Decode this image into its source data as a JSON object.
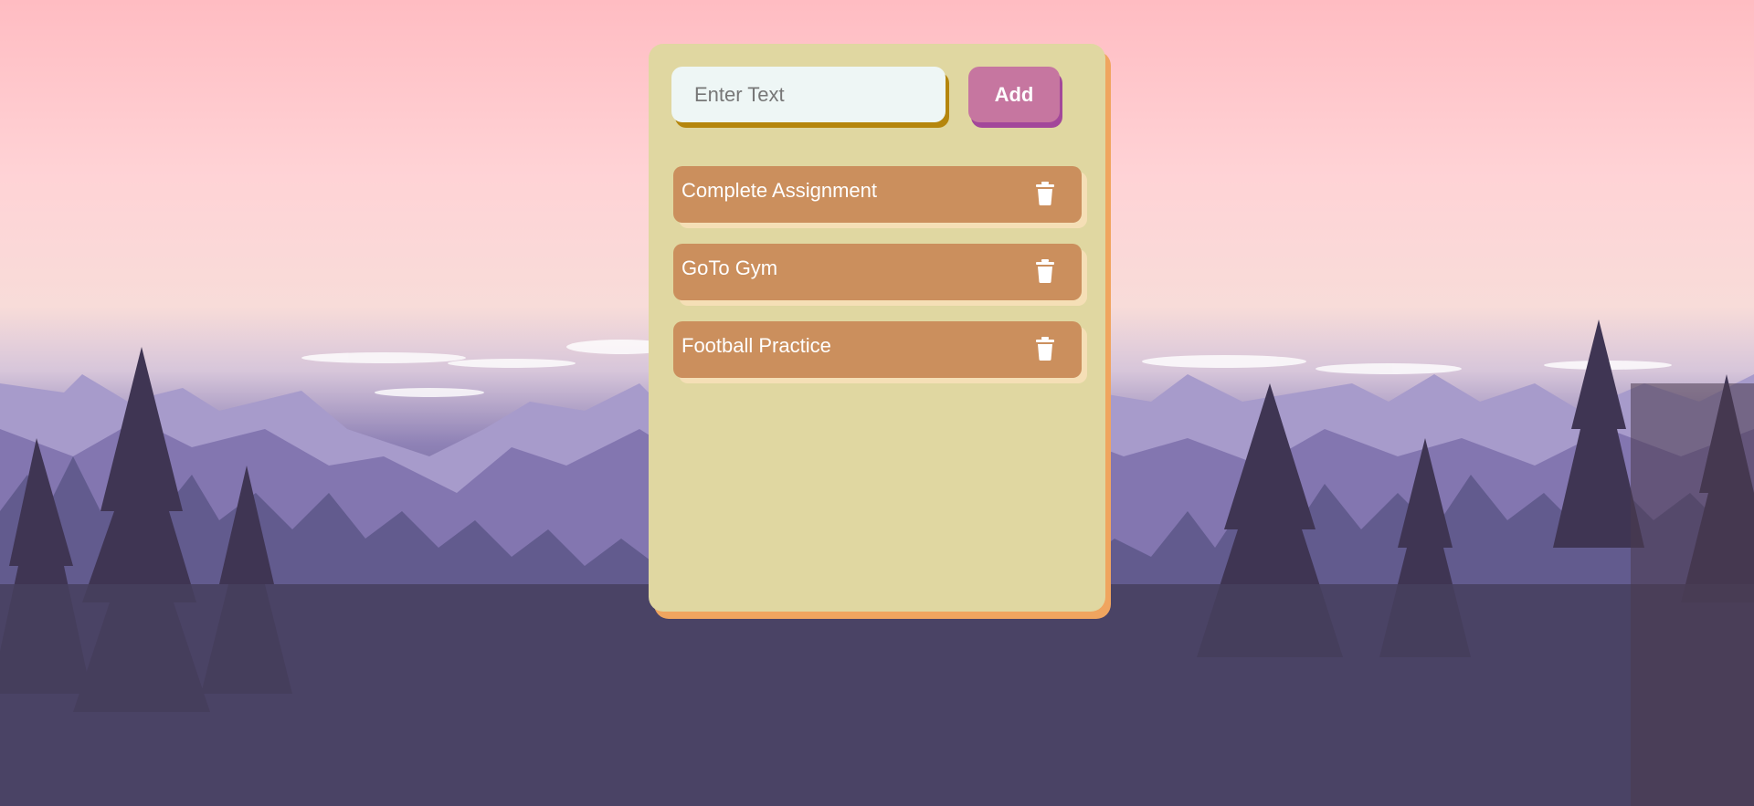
{
  "todo": {
    "input_placeholder": "Enter Text",
    "add_label": "Add",
    "tasks": [
      {
        "label": "Complete Assignment"
      },
      {
        "label": "GoTo Gym"
      },
      {
        "label": "Football Practice"
      }
    ],
    "delete_icon": "trash-icon"
  },
  "colors": {
    "card_bg": "#e0d7a1",
    "card_shadow": "#f0a55f",
    "input_bg": "#eef6f5",
    "input_shadow": "#b5860d",
    "add_button": "#c676a0",
    "add_button_shadow": "#a3479a",
    "task_bg": "#cb8f5d",
    "task_shadow": "#f5dfb6"
  }
}
